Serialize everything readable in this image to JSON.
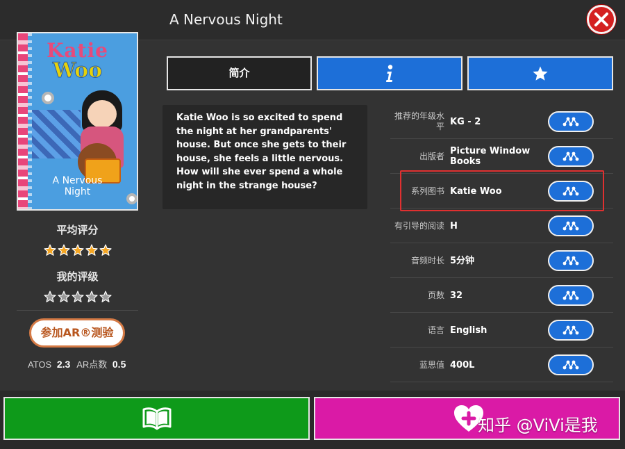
{
  "header": {
    "title": "A Nervous Night"
  },
  "cover": {
    "title_line1": "Katie",
    "title_line2": "Woo",
    "book_title_line1": "A Nervous",
    "book_title_line2": "Night"
  },
  "ratings": {
    "average_label": "平均评分",
    "average_stars": 5,
    "my_label": "我的评级",
    "my_stars": 0
  },
  "ar": {
    "button_label": "参加AR®测验",
    "atos_label": "ATOS",
    "atos_value": "2.3",
    "points_label": "AR点数",
    "points_value": "0.5"
  },
  "tabs": {
    "summary_label": "简介",
    "info_icon": "info-icon",
    "star_icon": "star-icon"
  },
  "description": "Katie Woo is so excited to spend the night at her grandparents' house. But once she gets to their house, she feels a little nervous. How will she ever spend a whole night in the strange house?",
  "details": [
    {
      "label": "推荐的年级水平",
      "value": "KG - 2"
    },
    {
      "label": "出版者",
      "value": "Picture Window Books"
    },
    {
      "label": "系列图书",
      "value": "Katie Woo"
    },
    {
      "label": "有引导的阅读",
      "value": "H"
    },
    {
      "label": "音频时长",
      "value": "5分钟"
    },
    {
      "label": "页数",
      "value": "32"
    },
    {
      "label": "语言",
      "value": "English"
    },
    {
      "label": "蓝思值",
      "value": "400L"
    }
  ],
  "bottom": {
    "read_icon": "open-book-icon",
    "fav_icon": "heart-plus-icon"
  },
  "watermark": "知乎 @ViVi是我",
  "colors": {
    "accent_blue": "#1d6fd8",
    "read_green": "#0e9a1a",
    "fav_magenta": "#da1aa6",
    "close_red": "#d42020",
    "highlight_red": "#e03030",
    "star_gold": "#f5a623"
  }
}
